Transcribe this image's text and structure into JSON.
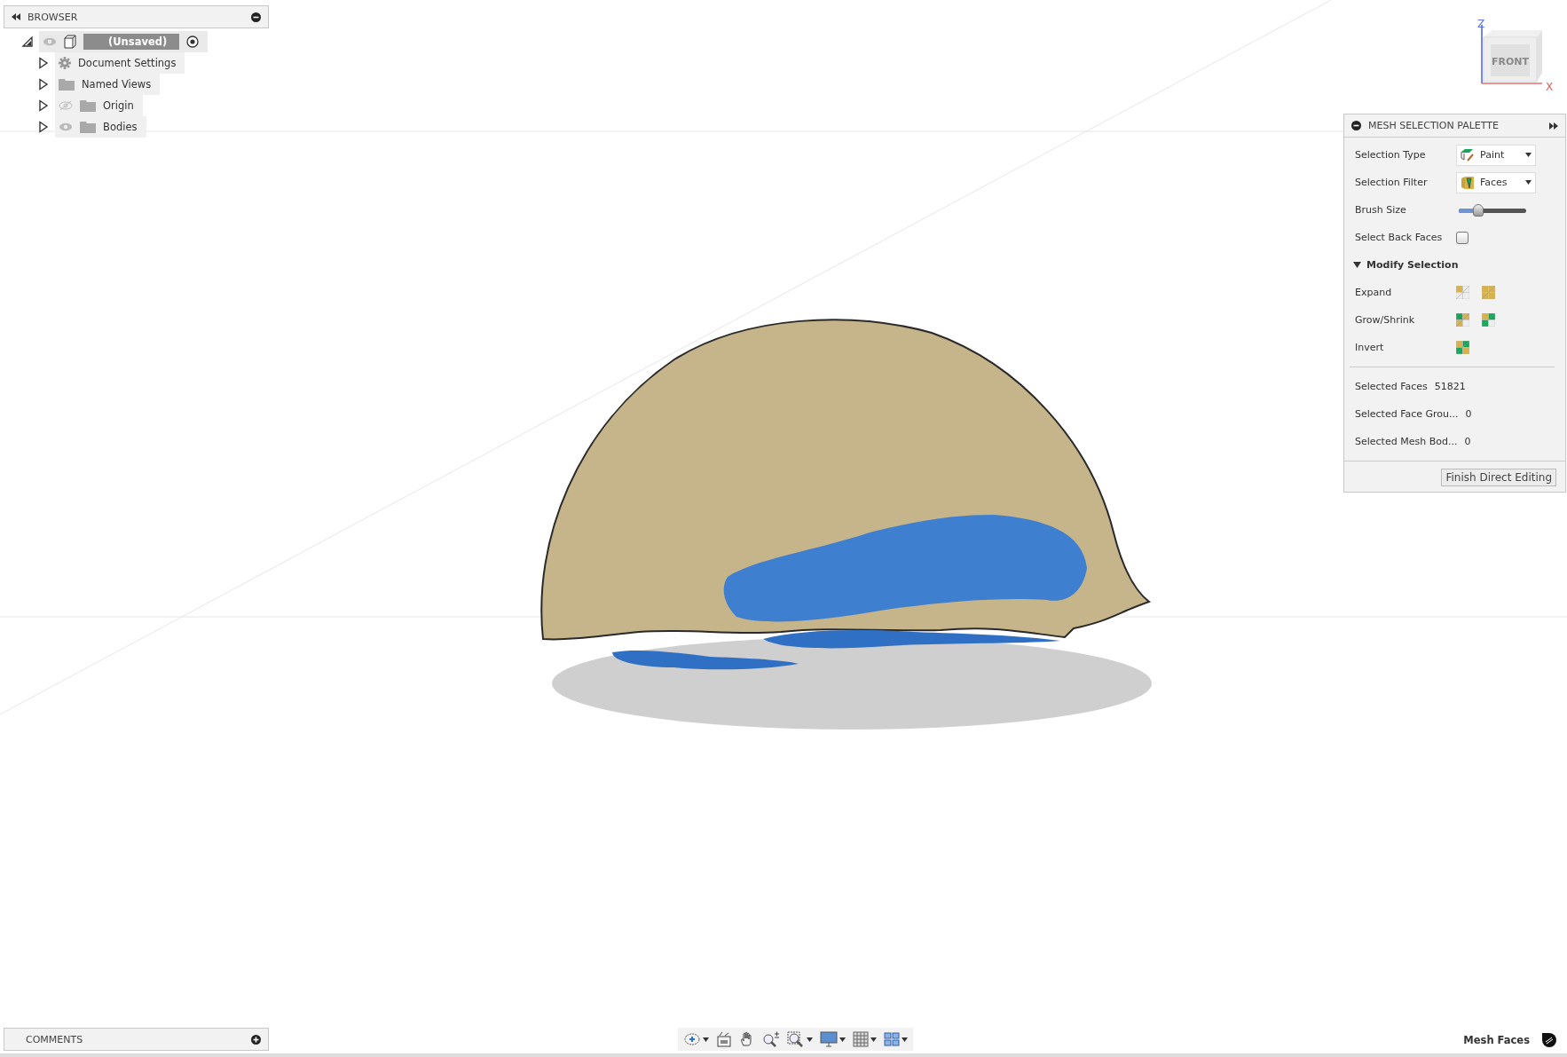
{
  "browser": {
    "title": "BROWSER",
    "tree": [
      {
        "label": "(Unsaved)",
        "kind": "root",
        "visible": true,
        "expanded": true,
        "children": [
          {
            "label": "Document Settings",
            "kind": "settings",
            "expanded": false
          },
          {
            "label": "Named Views",
            "kind": "folder",
            "expanded": false
          },
          {
            "label": "Origin",
            "kind": "folder",
            "visible": false,
            "expanded": false
          },
          {
            "label": "Bodies",
            "kind": "folder",
            "visible": true,
            "expanded": false
          }
        ]
      }
    ]
  },
  "view_cube": {
    "face": "FRONT",
    "axes": [
      "Z",
      "X"
    ]
  },
  "palette": {
    "title": "MESH SELECTION PALETTE",
    "rows": [
      {
        "kind": "dropdown",
        "label": "Selection Type",
        "value": "Paint"
      },
      {
        "kind": "dropdown",
        "label": "Selection Filter",
        "value": "Faces"
      },
      {
        "kind": "slider",
        "label": "Brush Size",
        "level": 0.25
      },
      {
        "kind": "checkbox",
        "label": "Select Back Faces",
        "checked": false
      }
    ],
    "section": {
      "label": "Modify Selection",
      "expanded": true,
      "rows": [
        {
          "label": "Expand"
        },
        {
          "label": "Grow/Shrink"
        },
        {
          "label": "Invert"
        }
      ]
    },
    "stats": [
      {
        "label": "Selected Faces",
        "value": "51821"
      },
      {
        "label": "Selected Face Grou...",
        "value": "0"
      },
      {
        "label": "Selected Mesh Bod...",
        "value": "0"
      }
    ],
    "button": "Finish Direct Editing"
  },
  "comments": {
    "title": "COMMENTS"
  },
  "status_bar": {
    "mode": "Mesh Faces"
  }
}
